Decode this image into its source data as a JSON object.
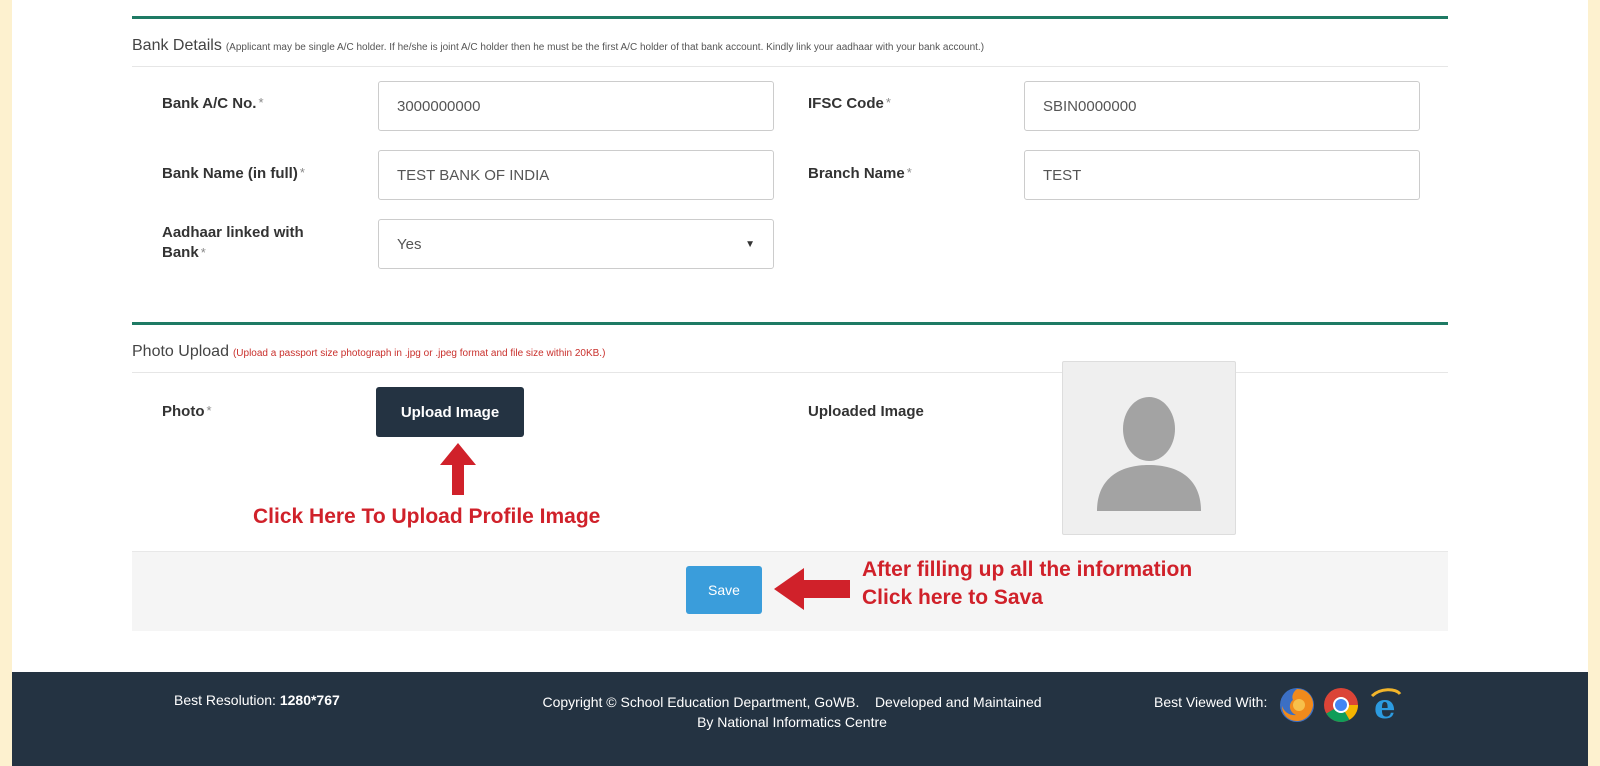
{
  "bank": {
    "title": "Bank Details",
    "note": "(Applicant may be single A/C holder. If he/she is joint A/C holder then he must be the first A/C holder of that bank account. Kindly link your aadhaar with your bank account.)",
    "acc_label": "Bank A/C No.",
    "acc_value": "3000000000",
    "ifsc_label": "IFSC Code",
    "ifsc_value": "SBIN0000000",
    "bank_name_label": "Bank Name (in full)",
    "bank_name_value": "TEST BANK OF INDIA",
    "branch_label": "Branch Name",
    "branch_value": "TEST",
    "aadhaar_label_line1": "Aadhaar linked with",
    "aadhaar_label_line2": "Bank",
    "aadhaar_value": "Yes",
    "required_mark": "*"
  },
  "photo": {
    "title": "Photo Upload",
    "note": "(Upload a passport size photograph in .jpg or .jpeg format and file size within 20KB.)",
    "photo_label": "Photo",
    "upload_button": "Upload Image",
    "uploaded_label": "Uploaded Image",
    "required_mark": "*"
  },
  "annotations": {
    "upload_hint": "Click Here To Upload Profile Image",
    "save_hint_line1": "After filling up all the information",
    "save_hint_line2": "Click here to Sava"
  },
  "actions": {
    "save_label": "Save"
  },
  "footer": {
    "resolution_label": "Best Resolution:",
    "resolution_value": "1280*767",
    "copyright_line1": "Copyright © School Education Department, GoWB.    Developed and Maintained",
    "copyright_line2": "By National Informatics Centre",
    "best_viewed": "Best Viewed With:",
    "browsers": [
      "firefox-icon",
      "chrome-icon",
      "ie-icon"
    ]
  },
  "colors": {
    "accent_green": "#1e7a64",
    "annotation_red": "#d0212a",
    "dark_navy": "#243342",
    "save_blue": "#3a9ddb",
    "page_border": "#fdf1cf"
  }
}
